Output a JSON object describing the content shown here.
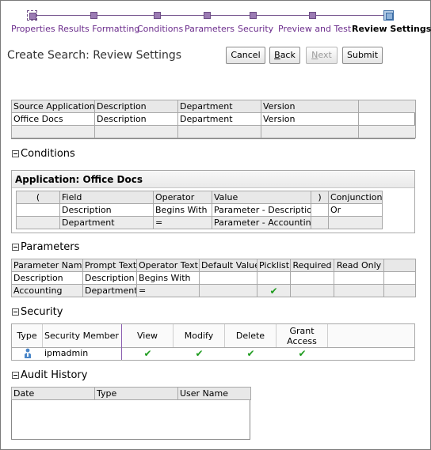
{
  "train": {
    "steps": [
      {
        "label": "Properties"
      },
      {
        "label": "Results Formatting"
      },
      {
        "label": "Conditions"
      },
      {
        "label": "Parameters"
      },
      {
        "label": "Security"
      },
      {
        "label": "Preview and Test"
      },
      {
        "label": "Review Settings"
      }
    ],
    "current_step": "Review Settings"
  },
  "header": {
    "title": "Create Search: Review Settings",
    "buttons": {
      "cancel": "Cancel",
      "back": "Back",
      "next": "Next",
      "submit": "Submit"
    }
  },
  "source_table": {
    "columns": [
      "Source Application",
      "Description",
      "Department",
      "Version"
    ],
    "rows": [
      [
        "Office Docs",
        "Description",
        "Department",
        "Version"
      ]
    ]
  },
  "conditions": {
    "section_title": "Conditions",
    "application_title": "Application: Office Docs",
    "columns": [
      "(",
      "Field",
      "Operator",
      "Value",
      ")",
      "Conjunction"
    ],
    "rows": [
      [
        "",
        "Description",
        "Begins With",
        "Parameter - Description",
        "",
        "Or"
      ],
      [
        "",
        "Department",
        "=",
        "Parameter - Accounting",
        "",
        ""
      ]
    ]
  },
  "parameters": {
    "section_title": "Parameters",
    "columns": [
      "Parameter Name",
      "Prompt Text",
      "Operator Text",
      "Default Value",
      "Picklist",
      "Required",
      "Read Only"
    ],
    "rows": [
      [
        "Description",
        "Description",
        "Begins With",
        "",
        "",
        "",
        ""
      ],
      [
        "Accounting",
        "Department",
        "=",
        "",
        "",
        "",
        ""
      ]
    ],
    "picklist_checked": [
      false,
      true
    ]
  },
  "security": {
    "section_title": "Security",
    "columns": {
      "type": "Type",
      "member": "Security Member",
      "view": "View",
      "modify": "Modify",
      "delete": "Delete",
      "grant": "Grant Access"
    },
    "rows": [
      {
        "type_icon": "user-icon",
        "member": "ipmadmin",
        "view": true,
        "modify": true,
        "delete": true,
        "grant": true
      }
    ]
  },
  "audit": {
    "section_title": "Audit History",
    "columns": [
      "Date",
      "Type",
      "User Name"
    ]
  },
  "colors": {
    "train": "#6b2c8c",
    "check": "#1e9b1e",
    "accent": "#3d6ea6"
  }
}
